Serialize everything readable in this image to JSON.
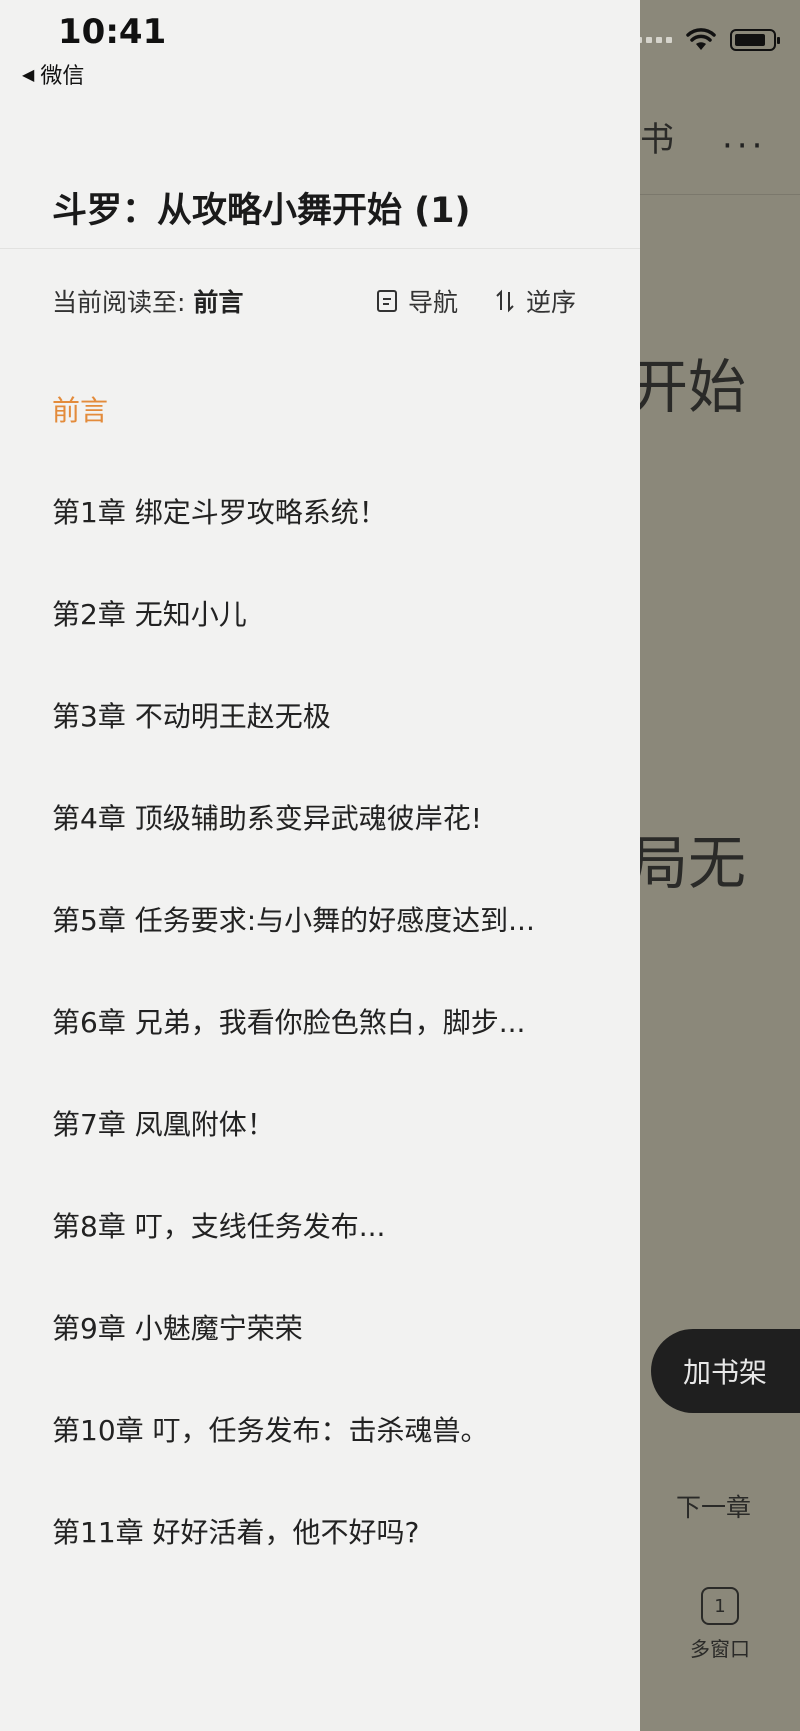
{
  "status_bar": {
    "time": "10:41",
    "back_label": "微信"
  },
  "background": {
    "header_title_fragment": "书",
    "more_label": "···",
    "text_fragment_1": "开始",
    "text_fragment_2": "局无"
  },
  "drawer": {
    "title": "斗罗：从攻略小舞开始 (1)",
    "progress_prefix": "当前阅读至:",
    "progress_chapter": "前言",
    "nav_label": "导航",
    "reverse_label": "逆序",
    "chapters": [
      "前言",
      "第1章 绑定斗罗攻略系统！",
      "第2章 无知小儿",
      "第3章 不动明王赵无极",
      "第4章 顶级辅助系变异武魂彼岸花!",
      "第5章 任务要求:与小舞的好感度达到...",
      "第6章 兄弟，我看你脸色煞白，脚步...",
      "第7章 凤凰附体！",
      "第8章 叮，支线任务发布...",
      "第9章 小魅魔宁荣荣",
      "第10章 叮，任务发布：击杀魂兽。",
      "第11章 好好活着，他不好吗?"
    ]
  },
  "floating": {
    "add_shelf_label": "加书架",
    "next_chapter_label": "下一章",
    "multi_window_count": "1",
    "multi_window_label": "多窗口"
  },
  "colors": {
    "accent": "#e38b3b",
    "overlay": "#8b887a",
    "drawer_bg": "#f2f2f1"
  }
}
